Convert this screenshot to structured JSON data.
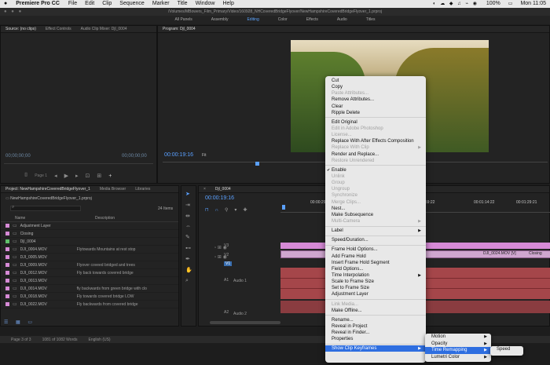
{
  "menubar": {
    "app": "Premiere Pro CC",
    "items": [
      "File",
      "Edit",
      "Clip",
      "Sequence",
      "Marker",
      "Title",
      "Window",
      "Help"
    ],
    "battery": "100%",
    "clock": "Mon 11:05"
  },
  "title_path": "/Volumes/MBowers_Film_Primary/Video/160928_NHCoveredBridgeFlyover/NewHampshireCoveredBridgeFlyover_1.prproj",
  "workspaces": {
    "items": [
      "All Panels",
      "Assembly",
      "Editing",
      "Color",
      "Effects",
      "Audio",
      "Titles"
    ],
    "active": "Editing"
  },
  "source_panel": {
    "tabs": [
      "Source: (no clips)",
      "Effect Controls",
      "Audio Clip Mixer: Djl_0004"
    ],
    "timecode_left": "00;00;00;00",
    "page": "Page 1",
    "timecode_right": "00;00;00;00"
  },
  "program_panel": {
    "tab": "Program: Djl_0004",
    "timecode": "00:00:19:16",
    "fit": "Fit"
  },
  "project_panel": {
    "tabs": [
      "Project: NewHampshireCoveredBridgeFlyover_1",
      "Media Browser",
      "Libraries"
    ],
    "file": "NewHampshireCoveredBridgeFlyover_1.prproj",
    "count": "24 Items",
    "col_name": "Name",
    "col_desc": "Description",
    "rows": [
      {
        "name": "Adjustment Layer",
        "desc": "",
        "color": "#d68ad6"
      },
      {
        "name": "Closing",
        "desc": "",
        "color": "#d68ad6"
      },
      {
        "name": "Djl_0004",
        "desc": "",
        "color": "#5fbf6a"
      },
      {
        "name": "DJI_0004.MOV",
        "desc": "Flytowards Mountains at rest stop",
        "color": "#d68ad6"
      },
      {
        "name": "DJI_0005.MOV",
        "desc": "",
        "color": "#d68ad6"
      },
      {
        "name": "DJI_0009.MOV",
        "desc": "Flyover coveed bridged and trees",
        "color": "#d68ad6"
      },
      {
        "name": "DJI_0012.MOV",
        "desc": "Fly back towards covered bridge",
        "color": "#d68ad6"
      },
      {
        "name": "DJI_0013.MOV",
        "desc": "",
        "color": "#d68ad6"
      },
      {
        "name": "DJI_0014.MOV",
        "desc": "fly backwards from green bridge with clo",
        "color": "#d68ad6"
      },
      {
        "name": "DJI_0018.MOV",
        "desc": "Fly towards covered bridge LOW",
        "color": "#d68ad6"
      },
      {
        "name": "DJI_0022.MOV",
        "desc": "Fly backwards from covered bridge",
        "color": "#d68ad6"
      }
    ]
  },
  "timeline": {
    "tab": "Djl_0004",
    "timecode": "00:00:19:16",
    "ruler": [
      "00:00:29",
      "00:00:59:22",
      "00:01:14:22",
      "00:01:29:21"
    ],
    "tracks": [
      "V3",
      "V2",
      "V1",
      "A1",
      "A2"
    ],
    "audio_labels": [
      "Audio 1",
      "Audio 2"
    ],
    "clip_labels": [
      "DJI_0024.MOV [V]",
      "Closing"
    ]
  },
  "statusbar": {
    "page": "Page 3 of 3",
    "words": "1081 of 1082 Words",
    "lang": "English (US)"
  },
  "context_menu": {
    "groups": [
      [
        {
          "label": "Cut"
        },
        {
          "label": "Copy"
        },
        {
          "label": "Paste Attributes...",
          "disabled": true
        },
        {
          "label": "Remove Attributes..."
        },
        {
          "label": "Clear"
        },
        {
          "label": "Ripple Delete"
        }
      ],
      [
        {
          "label": "Edit Original"
        },
        {
          "label": "Edit in Adobe Photoshop",
          "disabled": true
        },
        {
          "label": "License...",
          "disabled": true
        },
        {
          "label": "Replace With After Effects Composition"
        },
        {
          "label": "Replace With Clip",
          "disabled": true,
          "sub": true
        },
        {
          "label": "Render and Replace..."
        },
        {
          "label": "Restore Unrendered",
          "disabled": true
        }
      ],
      [
        {
          "label": "Enable",
          "checked": true
        },
        {
          "label": "Unlink",
          "disabled": true
        },
        {
          "label": "Group",
          "disabled": true
        },
        {
          "label": "Ungroup",
          "disabled": true
        },
        {
          "label": "Synchronize",
          "disabled": true
        },
        {
          "label": "Merge Clips...",
          "disabled": true
        },
        {
          "label": "Nest..."
        },
        {
          "label": "Make Subsequence"
        },
        {
          "label": "Multi-Camera",
          "disabled": true,
          "sub": true
        }
      ],
      [
        {
          "label": "Label",
          "sub": true
        }
      ],
      [
        {
          "label": "Speed/Duration..."
        }
      ],
      [
        {
          "label": "Frame Hold Options..."
        },
        {
          "label": "Add Frame Hold"
        },
        {
          "label": "Insert Frame Hold Segment"
        },
        {
          "label": "Field Options..."
        },
        {
          "label": "Time Interpolation",
          "sub": true
        },
        {
          "label": "Scale to Frame Size"
        },
        {
          "label": "Set to Frame Size"
        },
        {
          "label": "Adjustment Layer"
        }
      ],
      [
        {
          "label": "Link Media...",
          "disabled": true
        },
        {
          "label": "Make Offline..."
        }
      ],
      [
        {
          "label": "Rename..."
        },
        {
          "label": "Reveal in Project"
        },
        {
          "label": "Reveal in Finder..."
        },
        {
          "label": "Properties"
        }
      ],
      [
        {
          "label": "Show Clip Keyframes",
          "sub": true,
          "highlight": true
        }
      ]
    ]
  },
  "submenu_keyframes": {
    "items": [
      {
        "label": "Motion",
        "sub": true
      },
      {
        "label": "Opacity",
        "sub": true
      },
      {
        "label": "Time Remapping",
        "sub": true,
        "highlight": true
      },
      {
        "label": "Lumetri Color",
        "sub": true
      }
    ]
  },
  "submenu_timeremap": {
    "items": [
      {
        "label": "Speed"
      }
    ]
  },
  "colors": {
    "accent": "#2e6ee0",
    "timecode": "#5aa0ff",
    "clip_pink": "#d68ad6",
    "audio_red": "#b8464a"
  }
}
